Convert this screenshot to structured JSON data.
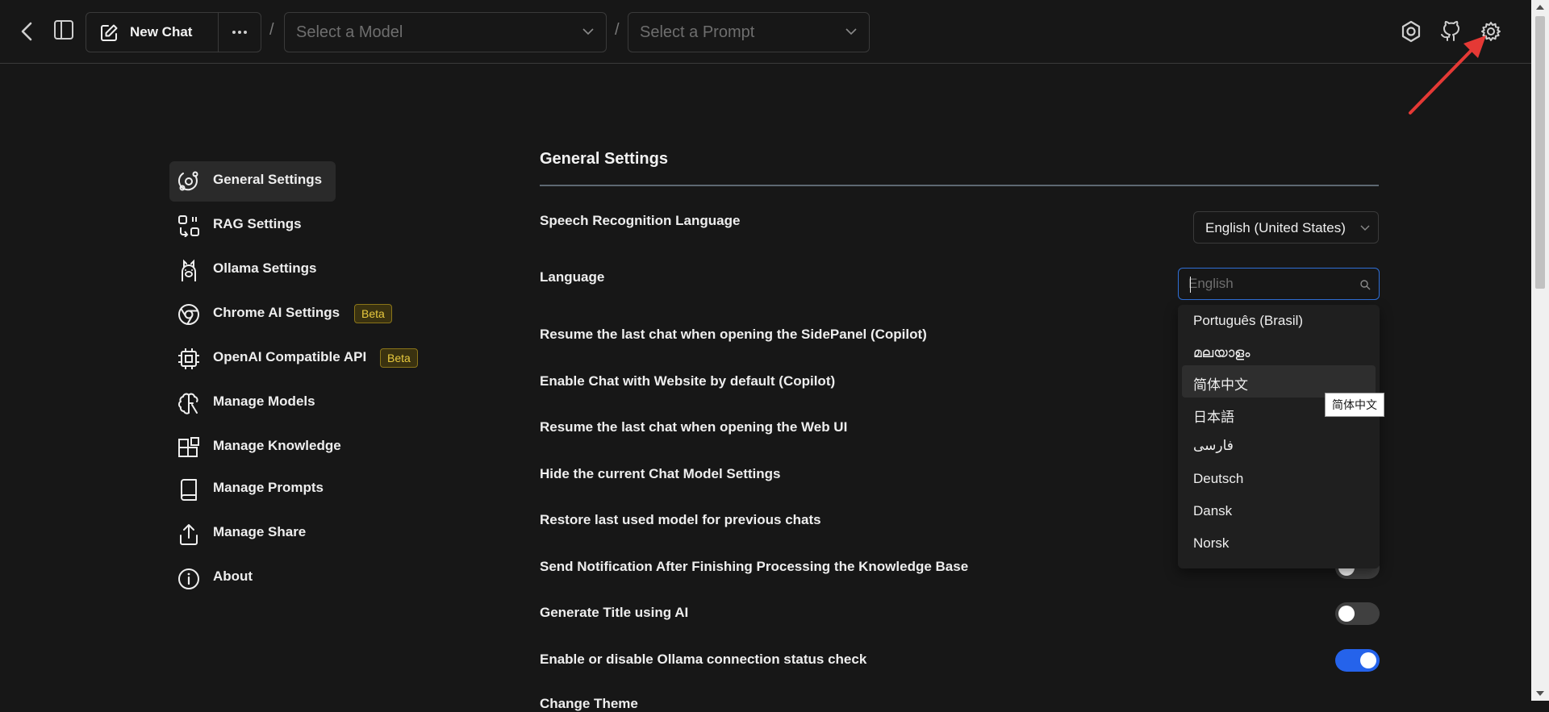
{
  "header": {
    "new_chat_label": "New Chat",
    "separator": "/",
    "model_select_placeholder": "Select a Model",
    "prompt_select_placeholder": "Select a Prompt"
  },
  "sidebar": {
    "items": [
      {
        "label": "General Settings",
        "icon": "orbit-icon",
        "active": true
      },
      {
        "label": "RAG Settings",
        "icon": "rag-icon"
      },
      {
        "label": "Ollama Settings",
        "icon": "llama-icon"
      },
      {
        "label": "Chrome AI Settings",
        "icon": "chrome-icon",
        "badge": "Beta"
      },
      {
        "label": "OpenAI Compatible API",
        "icon": "cpu-icon",
        "badge": "Beta"
      },
      {
        "label": "Manage Models",
        "icon": "brain-icon"
      },
      {
        "label": "Manage Knowledge",
        "icon": "blocks-icon"
      },
      {
        "label": "Manage Prompts",
        "icon": "book-icon"
      },
      {
        "label": "Manage Share",
        "icon": "share-icon"
      },
      {
        "label": "About",
        "icon": "info-icon"
      }
    ]
  },
  "main": {
    "title": "General Settings",
    "speech_label": "Speech Recognition Language",
    "speech_value": "English (United States)",
    "language_label": "Language",
    "language_placeholder": "English",
    "language_options": [
      "Português (Brasil)",
      "മലയാളം",
      "简体中文",
      "日本語",
      "فارسی",
      "Deutsch",
      "Dansk",
      "Norsk"
    ],
    "highlighted_option": "简体中文",
    "tooltip": "简体中文",
    "toggles": [
      {
        "label": "Resume the last chat when opening the SidePanel (Copilot)"
      },
      {
        "label": "Enable Chat with Website by default (Copilot)"
      },
      {
        "label": "Resume the last chat when opening the Web UI"
      },
      {
        "label": "Hide the current Chat Model Settings"
      },
      {
        "label": "Restore last used model for previous chats"
      },
      {
        "label": "Send Notification After Finishing Processing the Knowledge Base",
        "state": "off"
      },
      {
        "label": "Generate Title using AI",
        "state": "off"
      },
      {
        "label": "Enable or disable Ollama connection status check",
        "state": "on"
      }
    ],
    "cut_off_label": "Change Theme"
  },
  "colors": {
    "background": "#171717",
    "accent": "#2563eb",
    "beta": "#e8c93e",
    "annotation_arrow": "#e53935"
  }
}
